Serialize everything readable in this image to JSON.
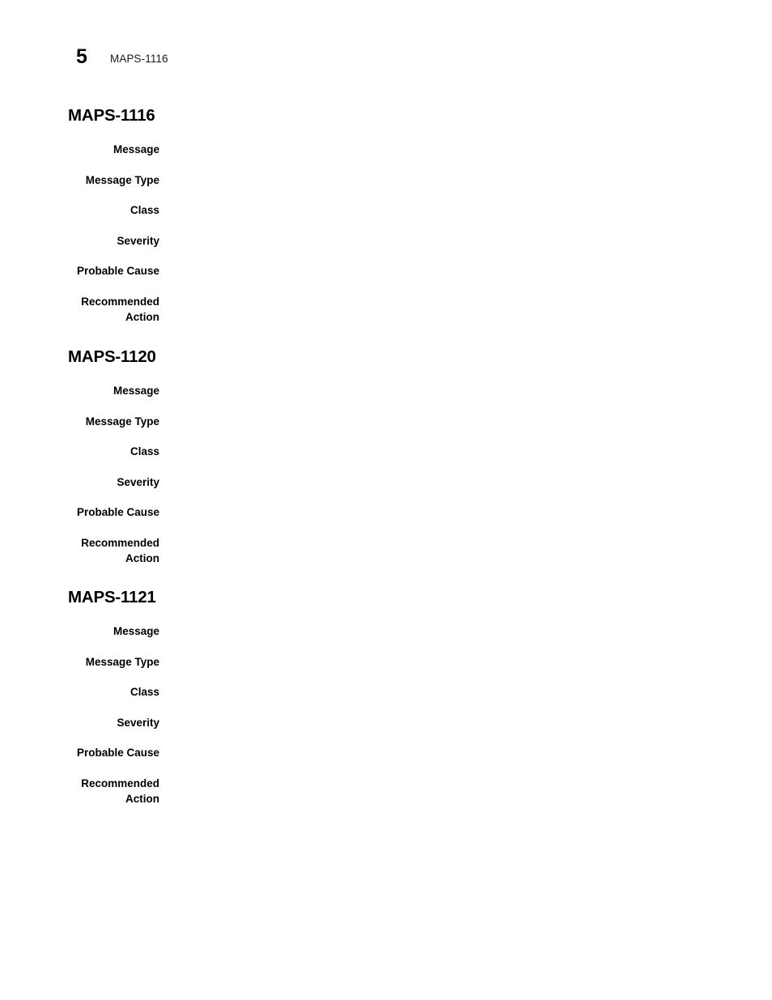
{
  "header": {
    "page_number": "5",
    "running_head": "MAPS-1116"
  },
  "field_labels": {
    "message": "Message",
    "message_type": "Message Type",
    "class": "Class",
    "severity": "Severity",
    "probable_cause": "Probable Cause",
    "recommended_action": "Recommended\nAction"
  },
  "sections": [
    {
      "title": "MAPS-1116",
      "fields": [
        {
          "label": "Message",
          "value": ""
        },
        {
          "label": "Message Type",
          "value": ""
        },
        {
          "label": "Class",
          "value": ""
        },
        {
          "label": "Severity",
          "value": ""
        },
        {
          "label": "Probable Cause",
          "value": ""
        },
        {
          "label": "Recommended\nAction",
          "value": ""
        }
      ]
    },
    {
      "title": "MAPS-1120",
      "fields": [
        {
          "label": "Message",
          "value": ""
        },
        {
          "label": "Message Type",
          "value": ""
        },
        {
          "label": "Class",
          "value": ""
        },
        {
          "label": "Severity",
          "value": ""
        },
        {
          "label": "Probable Cause",
          "value": ""
        },
        {
          "label": "Recommended\nAction",
          "value": ""
        }
      ]
    },
    {
      "title": "MAPS-1121",
      "fields": [
        {
          "label": "Message",
          "value": ""
        },
        {
          "label": "Message Type",
          "value": ""
        },
        {
          "label": "Class",
          "value": ""
        },
        {
          "label": "Severity",
          "value": ""
        },
        {
          "label": "Probable Cause",
          "value": ""
        },
        {
          "label": "Recommended\nAction",
          "value": ""
        }
      ]
    }
  ],
  "layout": {
    "section_tops": [
      131,
      429,
      726
    ]
  },
  "colors": {
    "text": "#000000",
    "running_head": "#1a1a1a",
    "background": "#ffffff"
  }
}
